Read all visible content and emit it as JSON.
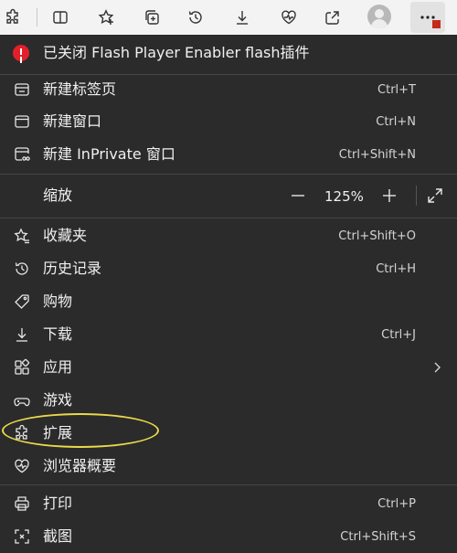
{
  "notification": {
    "text": "已关闭 Flash Player Enabler flash插件"
  },
  "menu": {
    "new_tab": {
      "label": "新建标签页",
      "shortcut": "Ctrl+T"
    },
    "new_window": {
      "label": "新建窗口",
      "shortcut": "Ctrl+N"
    },
    "new_inprivate": {
      "label": "新建 InPrivate 窗口",
      "shortcut": "Ctrl+Shift+N"
    },
    "zoom": {
      "label": "缩放",
      "value": "125%"
    },
    "favorites": {
      "label": "收藏夹",
      "shortcut": "Ctrl+Shift+O"
    },
    "history": {
      "label": "历史记录",
      "shortcut": "Ctrl+H"
    },
    "shopping": {
      "label": "购物"
    },
    "downloads": {
      "label": "下载",
      "shortcut": "Ctrl+J"
    },
    "apps": {
      "label": "应用"
    },
    "games": {
      "label": "游戏"
    },
    "extensions": {
      "label": "扩展"
    },
    "browser_essentials": {
      "label": "浏览器概要"
    },
    "print": {
      "label": "打印",
      "shortcut": "Ctrl+P"
    },
    "screenshot": {
      "label": "截图",
      "shortcut": "Ctrl+Shift+S"
    }
  },
  "toolbar_icons": [
    "extensions-icon",
    "split-screen-icon",
    "favorites-icon",
    "collections-icon",
    "history-icon",
    "downloads-icon",
    "browser-essentials-icon",
    "share-icon",
    "profile-avatar",
    "more-options-icon"
  ],
  "colors": {
    "menu_bg": "#2b2b2b",
    "toolbar_bg": "#f3f3f3",
    "alert_red": "#e3202a",
    "highlight_yellow": "#e9d94a"
  }
}
